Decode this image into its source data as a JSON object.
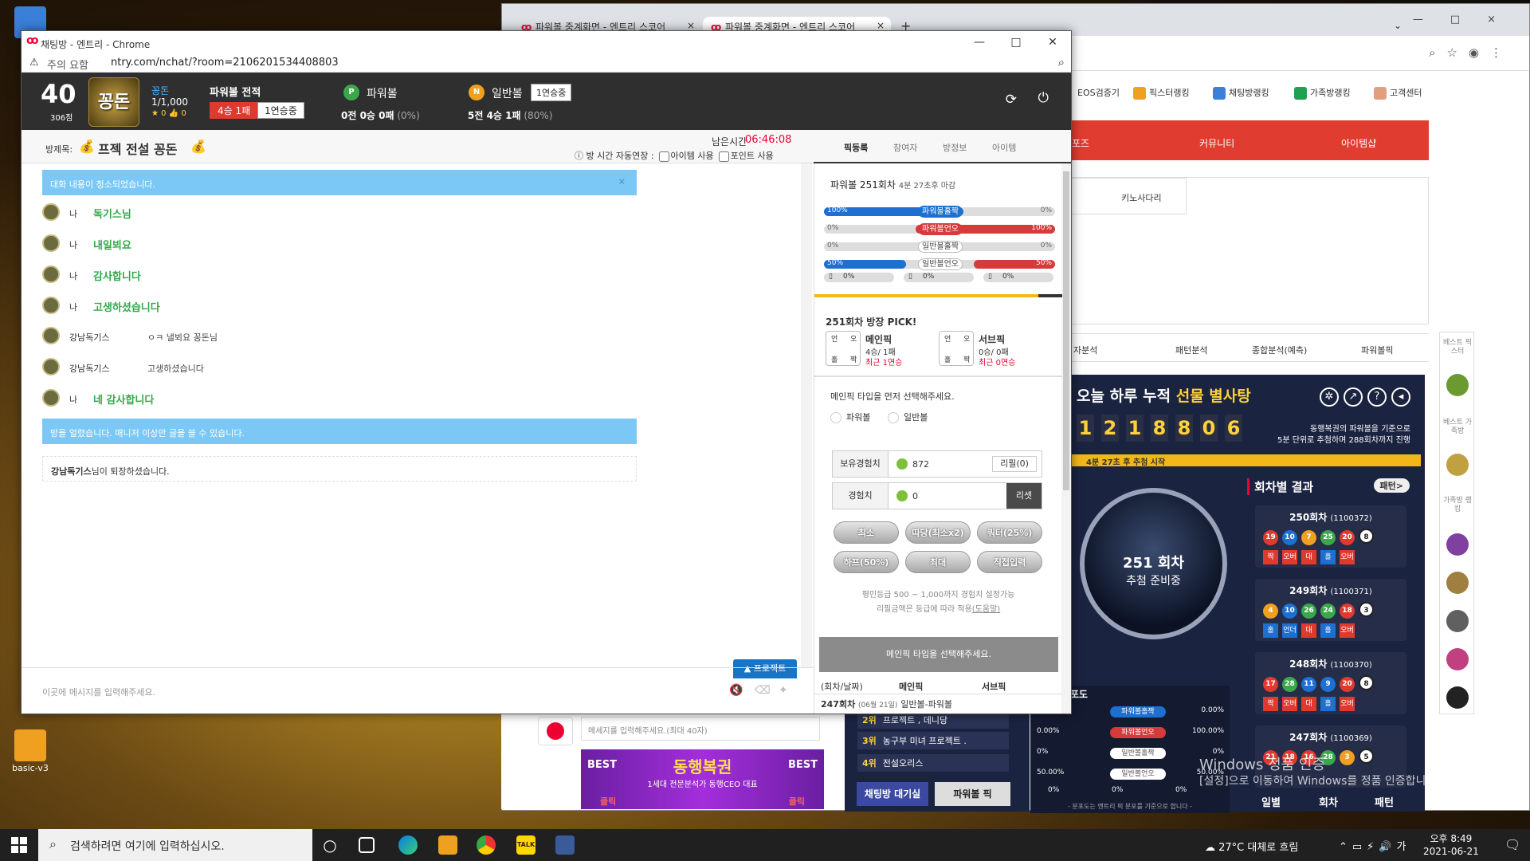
{
  "desktop": {
    "icon_label": "basic-v3"
  },
  "bg_browser": {
    "tabs": [
      "파워볼 중계화면 - 엔트리 스코어",
      "파워볼 중계화면 - 엔트리 스코어"
    ],
    "menu": [
      "EOS검증기",
      "픽스터랭킹",
      "채팅방랭킹",
      "가족방랭킹",
      "고객센터"
    ],
    "red_nav": [
      "포즈",
      "커뮤니티",
      "아이템샵"
    ],
    "sub_tab": "키노사다리",
    "analysis_tabs": [
      "자분석",
      "패턴분석",
      "종합분석(예측)",
      "파워볼픽"
    ],
    "powerball": {
      "title_pre": "오늘 하루 누적 ",
      "title_em": "선물 별사탕",
      "digits": [
        "1",
        "2",
        "1",
        "8",
        "8",
        "0",
        "6"
      ],
      "desc1": "동행복권의 파워볼을 기준으로",
      "desc2": "5분 단위로 추첨하며 288회차까지 진행",
      "bar_text": "4분 27초 후 추첨 시작",
      "ball_round": "251 회차",
      "ball_status": "추첨 준비중",
      "results_title": "회차별 결과",
      "more_label": "패턴>",
      "rounds": [
        {
          "title": "250회차",
          "id": "(1100372)",
          "balls": [
            "19",
            "10",
            "7",
            "25",
            "20",
            "8"
          ],
          "tags": [
            "짝",
            "오버",
            "대",
            "홀",
            "오버"
          ]
        },
        {
          "title": "249회차",
          "id": "(1100371)",
          "balls": [
            "4",
            "10",
            "26",
            "24",
            "18",
            "3"
          ],
          "tags": [
            "홀",
            "언더",
            "대",
            "홀",
            "오버"
          ]
        },
        {
          "title": "248회차",
          "id": "(1100370)",
          "balls": [
            "17",
            "28",
            "11",
            "9",
            "20",
            "8"
          ],
          "tags": [
            "짝",
            "오버",
            "대",
            "홀",
            "오버"
          ]
        },
        {
          "title": "247회차",
          "id": "(1100369)",
          "balls": [
            "21",
            "18",
            "16",
            "28",
            "3",
            "5"
          ],
          "tags": []
        }
      ],
      "bottom_tabs": [
        "일별",
        "회차",
        "패턴"
      ]
    },
    "stats": {
      "section_label": "포도",
      "rows": [
        {
          "label": "파워볼홀짝",
          "left": "",
          "right": "0.00%"
        },
        {
          "label": "파워볼언오",
          "left": "0.00%",
          "right": "100.00%"
        },
        {
          "label": "일반볼홀짝",
          "left": "0%",
          "right": "0%"
        },
        {
          "label": "일반볼언오",
          "left": "50.00%",
          "right": "50.00%"
        }
      ],
      "foot": [
        "0%",
        "0%",
        "0%"
      ],
      "note": "- 분포도는 엔트리 픽 분포를 기준으로 합니다 -"
    },
    "ranking": [
      {
        "rank": "2위",
        "name": "프로젝트 , 데니당"
      },
      {
        "rank": "3위",
        "name": "농구부 미녀 프로젝트 ."
      },
      {
        "rank": "4위",
        "name": "전설오리스"
      }
    ],
    "footer_buttons": [
      "채팅방 대기실",
      "파워볼 픽"
    ],
    "chat_input_placeholder": "메세지를 입력해주세요.(최대 40자)",
    "banner": {
      "title": "동행복권",
      "sub": "1세대 전문분석가 동행CEO 대표",
      "best": "BEST",
      "click": "클릭"
    },
    "side": [
      "베스트 픽스터",
      "베스트 가족방",
      "가족방 랭킹"
    ]
  },
  "watermark": {
    "line1": "Windows 정품 인증",
    "line2": "[설정]으로 이동하여 Windows를 정품 인증합니다."
  },
  "window": {
    "title": "채팅방 - 엔트리 - Chrome",
    "warn": "주의 요함",
    "url": "ntry.com/nchat/?room=2106201534408803"
  },
  "header": {
    "level": "40",
    "level_sub": "306점",
    "avatar_text": "꽁돈",
    "nick": "꽁돈",
    "score": "1/1,000",
    "badges": "★ 0 👍 0",
    "record_title": "파워볼 전적",
    "record_win": "4승 1패",
    "record_streak": "1연승중",
    "pw_label": "파워볼",
    "pw_stat": "0전 0승 0패",
    "pw_pct": "(0%)",
    "nb_label": "일반볼",
    "nb_badge": "1연승중",
    "nb_stat": "5전 4승 1패",
    "nb_pct": "(80%)"
  },
  "room": {
    "label": "방제목:",
    "name": "프젝 전설 꽁돈",
    "time_label": "남은시간",
    "time_value": "06:46:08",
    "auto_ext": "방 시간 자동연장 :",
    "opt_item": "아이템 사용",
    "opt_point": "포인트 사용"
  },
  "right_tabs": [
    "픽등록",
    "참여자",
    "방정보",
    "아이템"
  ],
  "chat": {
    "notice_top": "대화 내용이 청소되었습니다.",
    "messages": [
      {
        "who": "나",
        "text": "독기스님",
        "style": "g"
      },
      {
        "who": "나",
        "text": "내일뵈요",
        "style": "g"
      },
      {
        "who": "나",
        "text": "감사합니다",
        "style": "g"
      },
      {
        "who": "나",
        "text": "고생하셨습니다",
        "style": "g"
      },
      {
        "who": "강남독기스",
        "text": "ㅇㅋ 낼뵈요 꽁돈님",
        "style": "n"
      },
      {
        "who": "강남독기스",
        "text": "고생하셨습니다",
        "style": "n"
      },
      {
        "who": "나",
        "text": "네 감사합니다",
        "style": "g"
      }
    ],
    "notice_bottom": "방을 얼렸습니다. 매니저 이상만 글을 쓸 수 있습니다.",
    "entry_user": "강남독기스",
    "entry_text": "님이 퇴장하셨습니다.",
    "project_btn": "▲ 프로젝트",
    "input_placeholder": "이곳에 메시지를 입력해주세요."
  },
  "pick": {
    "head": "파워볼 251회차",
    "head_sub": "4분 27초후 마감",
    "rows": [
      {
        "label": "파워볼홀짝",
        "left": "100%",
        "right": "0%",
        "left_fill": 0.5,
        "right_fill": 0,
        "mode": "blue"
      },
      {
        "label": "파워볼언오",
        "left": "0%",
        "right": "100%",
        "left_fill": 0,
        "right_fill": 0.5,
        "mode": "red"
      },
      {
        "label": "일반볼홀짝",
        "left": "0%",
        "right": "0%",
        "left_fill": 0,
        "right_fill": 0,
        "mode": "none"
      },
      {
        "label": "일반볼언오",
        "left": "50%",
        "right": "50%",
        "left_fill": 0.25,
        "right_fill": 0.25,
        "mode": "none"
      }
    ],
    "sizes": [
      "0%",
      "0%",
      "0%"
    ],
    "round_pick": "251회차 방장 PICK!",
    "main_label": "메인픽",
    "main_sub": "4승/ 1패",
    "main_streak": "최근 1연승",
    "sub_label": "서브픽",
    "sub_sub": "0승/ 0패",
    "sub_streak": "최근 0연승",
    "box_chars": [
      "언",
      "오",
      "홀",
      "짝"
    ],
    "select_prompt": "메인픽 타입을 먼저 선택해주세요.",
    "radio_pb": "파워볼",
    "radio_nb": "일반볼",
    "exp_have": "보유경험치",
    "exp_have_val": "872",
    "refill": "리필(0)",
    "exp": "경험치",
    "exp_val": "0",
    "reset": "리셋",
    "pills": [
      "최소",
      "따당(최소x2)",
      "쿼터(25%)",
      "하프(50%)",
      "최대",
      "직접입력"
    ],
    "note1": "평민등급 500 ~ 1,000까지 경험치 설정가능",
    "note2": "리필금액은 등급에 따라 적용",
    "note_link": "(도움말)",
    "submit": "메인픽 타입을 선택해주세요.",
    "col_round": "(회차/날짜)",
    "col_main": "메인픽",
    "col_sub": "서브픽",
    "last_round": "247회차",
    "last_date": "(06월 21일)",
    "last_type": "일반볼-파워볼"
  },
  "taskbar": {
    "search": "검색하려면 여기에 입력하십시오.",
    "weather": "27°C 대체로 흐림",
    "time": "오후 8:49",
    "date": "2021-06-21"
  }
}
